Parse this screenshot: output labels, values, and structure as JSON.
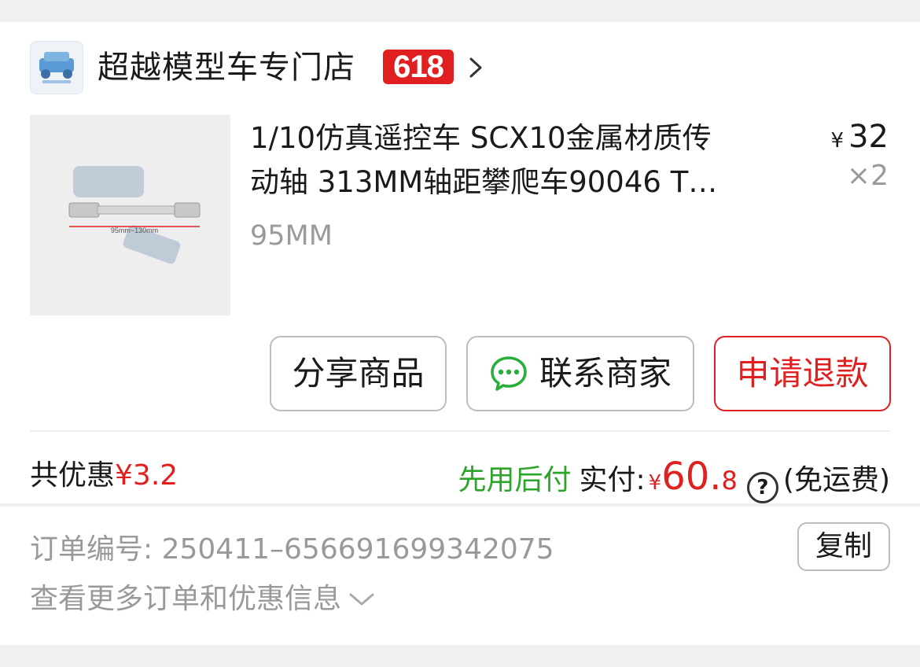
{
  "shop": {
    "name": "超越模型车专门店",
    "badge": "618"
  },
  "product": {
    "title_line1": "1/10仿真遥控车 SCX10金属材质传",
    "title_line2": "动轴 313MM轴距攀爬车90046 T…",
    "spec": "95MM",
    "image_caption": "95mm~130mm",
    "price_symbol": "¥",
    "price": "32",
    "quantity": "×2"
  },
  "actions": {
    "share": "分享商品",
    "contact": "联系商家",
    "refund": "申请退款"
  },
  "summary": {
    "discount_label": "共优惠",
    "discount_amount": "¥3.2",
    "pay_later": "先用后付",
    "paid_label": "实付:",
    "paid_symbol": "¥",
    "paid_int": "60.",
    "paid_dec": "8",
    "help": "?",
    "shipping": "(免运费)"
  },
  "order": {
    "number_label": "订单编号:",
    "number": "250411–656691699342075",
    "copy": "复制",
    "more": "查看更多订单和优惠信息"
  },
  "colors": {
    "accent_red": "#e02020",
    "pay_later_green": "#2aa52a",
    "wechat_green": "#2aae3a"
  }
}
